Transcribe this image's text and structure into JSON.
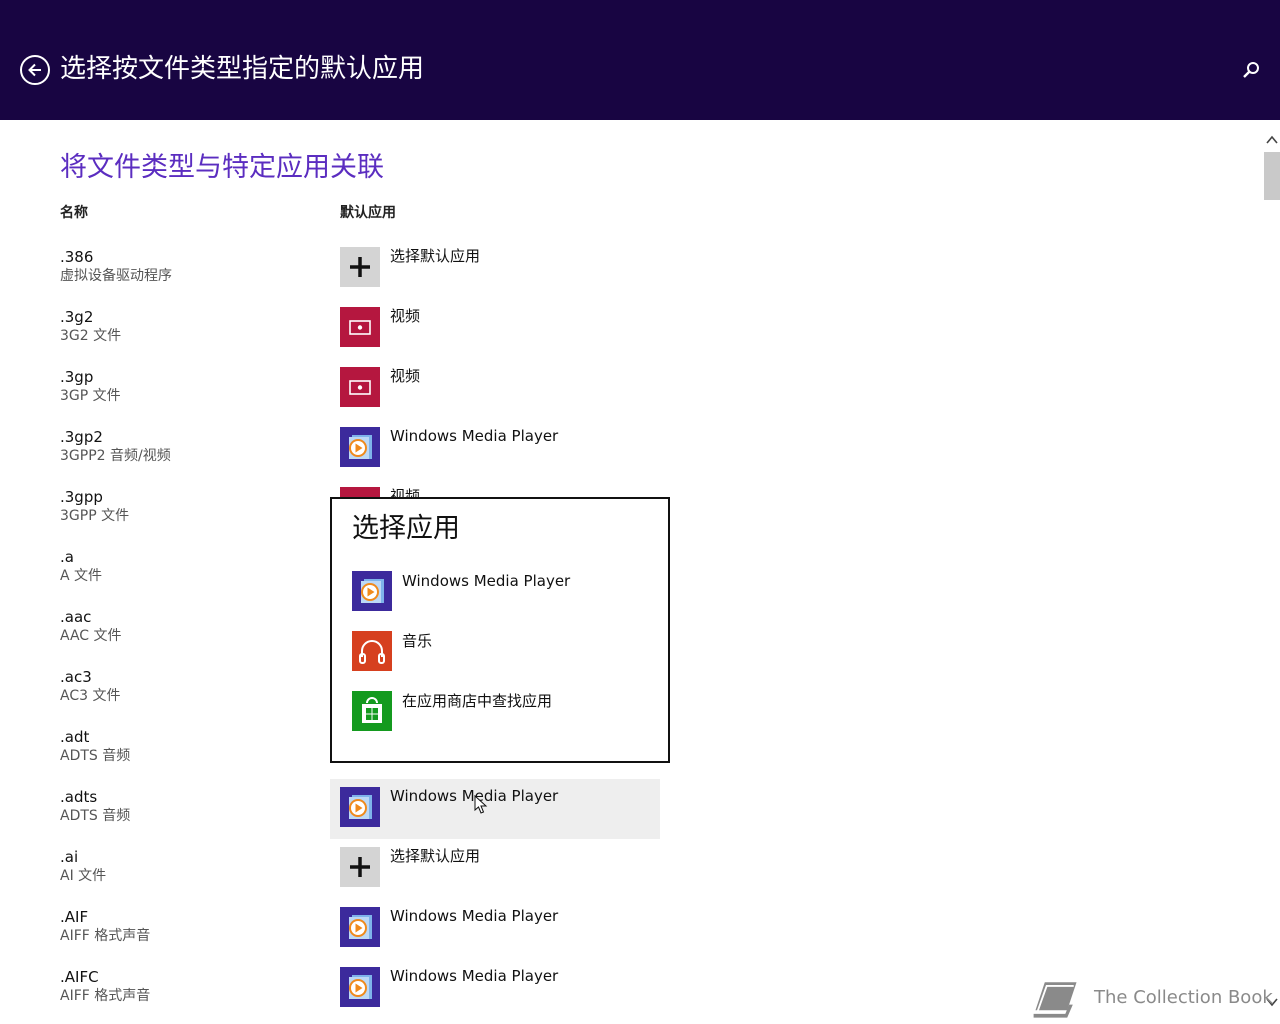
{
  "header": {
    "title": "选择按文件类型指定的默认应用",
    "back_icon": "back-arrow-icon",
    "search_icon": "search-icon",
    "background": "#180542"
  },
  "section_title": "将文件类型与特定应用关联",
  "columns": {
    "name": "名称",
    "default_app": "默认应用"
  },
  "rows": [
    {
      "ext": ".386",
      "desc": "虚拟设备驱动程序",
      "app": "选择默认应用",
      "icon": "plus-icon"
    },
    {
      "ext": ".3g2",
      "desc": "3G2 文件",
      "app": "视频",
      "icon": "video-icon"
    },
    {
      "ext": ".3gp",
      "desc": "3GP 文件",
      "app": "视频",
      "icon": "video-icon"
    },
    {
      "ext": ".3gp2",
      "desc": "3GPP2 音频/视频",
      "app": "Windows Media Player",
      "icon": "media-player-icon"
    },
    {
      "ext": ".3gpp",
      "desc": "3GPP 文件",
      "app": "视频",
      "icon": "video-icon"
    },
    {
      "ext": ".a",
      "desc": "A 文件",
      "app": "",
      "icon": ""
    },
    {
      "ext": ".aac",
      "desc": "AAC 文件",
      "app": "",
      "icon": ""
    },
    {
      "ext": ".ac3",
      "desc": "AC3 文件",
      "app": "",
      "icon": ""
    },
    {
      "ext": ".adt",
      "desc": "ADTS 音频",
      "app": "",
      "icon": ""
    },
    {
      "ext": ".adts",
      "desc": "ADTS 音频",
      "app": "Windows Media Player",
      "icon": "media-player-icon"
    },
    {
      "ext": ".ai",
      "desc": "AI 文件",
      "app": "选择默认应用",
      "icon": "plus-icon"
    },
    {
      "ext": ".AIF",
      "desc": "AIFF 格式声音",
      "app": "Windows Media Player",
      "icon": "media-player-icon"
    },
    {
      "ext": ".AIFC",
      "desc": "AIFF 格式声音",
      "app": "Windows Media Player",
      "icon": "media-player-icon"
    }
  ],
  "popup": {
    "title": "选择应用",
    "items": [
      {
        "label": "Windows Media Player",
        "icon": "media-player-icon"
      },
      {
        "label": "音乐",
        "icon": "music-icon"
      },
      {
        "label": "在应用商店中查找应用",
        "icon": "store-icon"
      }
    ]
  },
  "watermark": "The Collection Book",
  "colors": {
    "accent": "#5b2dc0",
    "video": "#b5173f",
    "media_player": "#3c2a9c",
    "music": "#d6401f",
    "store": "#149a1f"
  }
}
